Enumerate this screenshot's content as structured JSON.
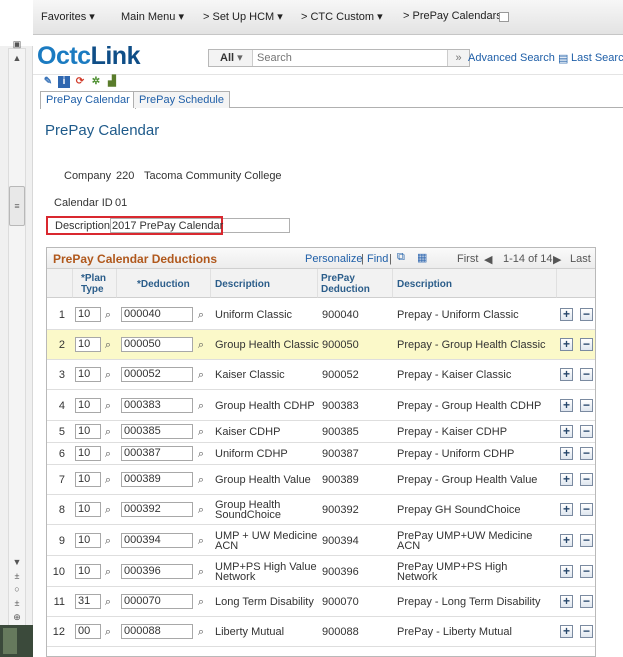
{
  "nav": {
    "favorites": "Favorites ▾",
    "main_menu": "Main Menu ▾",
    "crumb1": "> Set Up HCM ▾",
    "crumb2": "> CTC Custom ▾",
    "crumb3": "> PrePay Calendars"
  },
  "header": {
    "logo_a": "Octc",
    "logo_b": "Link",
    "search_category": "All",
    "search_placeholder": "Search",
    "go": "»",
    "advanced_search": "Advanced Search",
    "last_search": "Last Search"
  },
  "toolbar_icons": [
    "pencil-icon",
    "info-icon",
    "refresh-icon",
    "gear-icon",
    "chart-icon"
  ],
  "tabs": [
    {
      "label": "PrePay Calendar",
      "active": true
    },
    {
      "label": "PrePay Schedule",
      "active": false
    }
  ],
  "page_title": "PrePay Calendar",
  "fields": {
    "company_label": "Company",
    "company_code": "220",
    "company_name": "Tacoma Community College",
    "calendar_id_label": "Calendar ID",
    "calendar_id": "01",
    "description_label": "Description",
    "description_value": "2017 PrePay Calendar"
  },
  "grid": {
    "title": "PrePay Calendar Deductions",
    "personalize": "Personalize",
    "find": "Find",
    "pipe1": "|",
    "pipe2": "|",
    "first": "First",
    "range": "1-14 of 14",
    "last": "Last",
    "columns": {
      "plan_type_1": "*Plan",
      "plan_type_2": "Type",
      "deduction": "*Deduction",
      "description": "Description",
      "prepay_ded_1": "PrePay",
      "prepay_ded_2": "Deduction",
      "description2": "Description"
    },
    "rows": [
      {
        "n": "1",
        "plan": "10",
        "ded": "000040",
        "desc": "Uniform Classic",
        "desc2": "",
        "pp": "900040",
        "ppdesc": "Prepay - Uniform Classic",
        "ppdesc2": ""
      },
      {
        "n": "2",
        "plan": "10",
        "ded": "000050",
        "desc": "Group Health Classic",
        "desc2": "",
        "pp": "900050",
        "ppdesc": "Prepay - Group Health Classic",
        "ppdesc2": ""
      },
      {
        "n": "3",
        "plan": "10",
        "ded": "000052",
        "desc": "Kaiser Classic",
        "desc2": "",
        "pp": "900052",
        "ppdesc": "Prepay - Kaiser Classic",
        "ppdesc2": ""
      },
      {
        "n": "4",
        "plan": "10",
        "ded": "000383",
        "desc": "Group Health CDHP",
        "desc2": "",
        "pp": "900383",
        "ppdesc": "Prepay - Group Health CDHP",
        "ppdesc2": ""
      },
      {
        "n": "5",
        "plan": "10",
        "ded": "000385",
        "desc": "Kaiser CDHP",
        "desc2": "",
        "pp": "900385",
        "ppdesc": "Prepay - Kaiser CDHP",
        "ppdesc2": ""
      },
      {
        "n": "6",
        "plan": "10",
        "ded": "000387",
        "desc": "Uniform CDHP",
        "desc2": "",
        "pp": "900387",
        "ppdesc": "Prepay - Uniform CDHP",
        "ppdesc2": ""
      },
      {
        "n": "7",
        "plan": "10",
        "ded": "000389",
        "desc": "Group Health Value",
        "desc2": "",
        "pp": "900389",
        "ppdesc": "Prepay - Group Health Value",
        "ppdesc2": ""
      },
      {
        "n": "8",
        "plan": "10",
        "ded": "000392",
        "desc": "Group Health",
        "desc2": "SoundChoice",
        "pp": "900392",
        "ppdesc": "Prepay GH SoundChoice",
        "ppdesc2": ""
      },
      {
        "n": "9",
        "plan": "10",
        "ded": "000394",
        "desc": "UMP + UW Medicine",
        "desc2": "ACN",
        "pp": "900394",
        "ppdesc": "PrePay UMP+UW Medicine",
        "ppdesc2": "ACN"
      },
      {
        "n": "10",
        "plan": "10",
        "ded": "000396",
        "desc": "UMP+PS High Value",
        "desc2": "Network",
        "pp": "900396",
        "ppdesc": "PrePay UMP+PS High",
        "ppdesc2": "Network"
      },
      {
        "n": "11",
        "plan": "31",
        "ded": "000070",
        "desc": "Long Term Disability",
        "desc2": "",
        "pp": "900070",
        "ppdesc": "Prepay - Long Term Disability",
        "ppdesc2": ""
      },
      {
        "n": "12",
        "plan": "00",
        "ded": "000088",
        "desc": "Liberty Mutual",
        "desc2": "",
        "pp": "900088",
        "ppdesc": "PrePay - Liberty Mutual",
        "ppdesc2": ""
      }
    ]
  },
  "colors": {
    "accent": "#1f5fa8",
    "grid_title": "#b0581c",
    "highlight_row": "#fbf9c9",
    "callout": "#d9282f"
  }
}
